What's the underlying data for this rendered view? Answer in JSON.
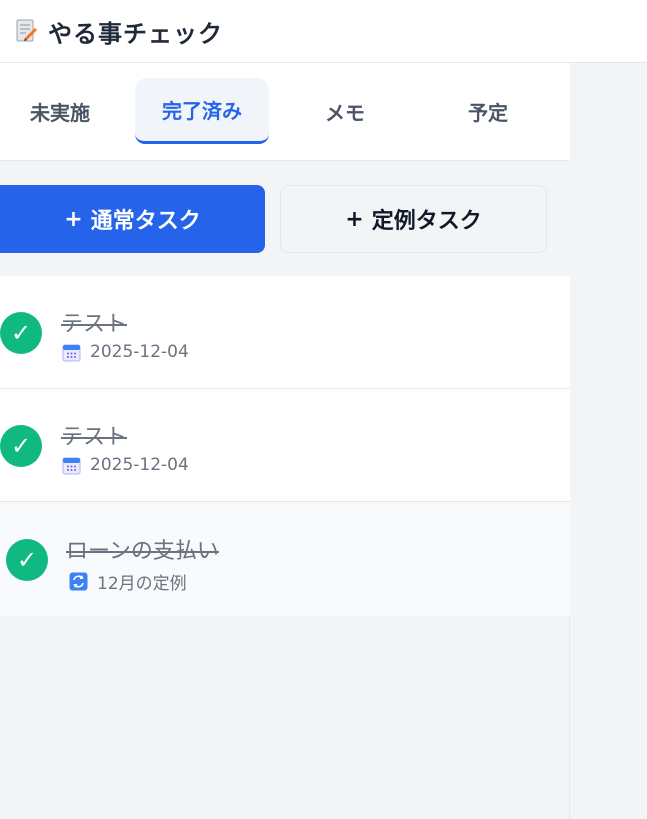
{
  "header": {
    "title": "やる事チェック",
    "icon": "memo-pencil-icon"
  },
  "tabs": [
    {
      "label": "未実施",
      "active": false
    },
    {
      "label": "完了済み",
      "active": true
    },
    {
      "label": "メモ",
      "active": false
    },
    {
      "label": "予定",
      "active": false
    }
  ],
  "actions": {
    "normal_task": {
      "plus": "+",
      "label": "通常タスク"
    },
    "recurring_task": {
      "plus": "+",
      "label": "定例タスク"
    }
  },
  "tasks": [
    {
      "title": "テスト",
      "meta": "2025-12-04",
      "meta_icon": "calendar-icon",
      "status": "completed"
    },
    {
      "title": "テスト",
      "meta": "2025-12-04",
      "meta_icon": "calendar-icon",
      "status": "completed"
    },
    {
      "title": "ローンの支払い",
      "meta": "12月の定例",
      "meta_icon": "repeat-icon",
      "status": "completed"
    }
  ],
  "check_glyph": "✓",
  "colors": {
    "accent": "#2563eb",
    "done": "#10b981",
    "muted_text": "#6b7280"
  }
}
